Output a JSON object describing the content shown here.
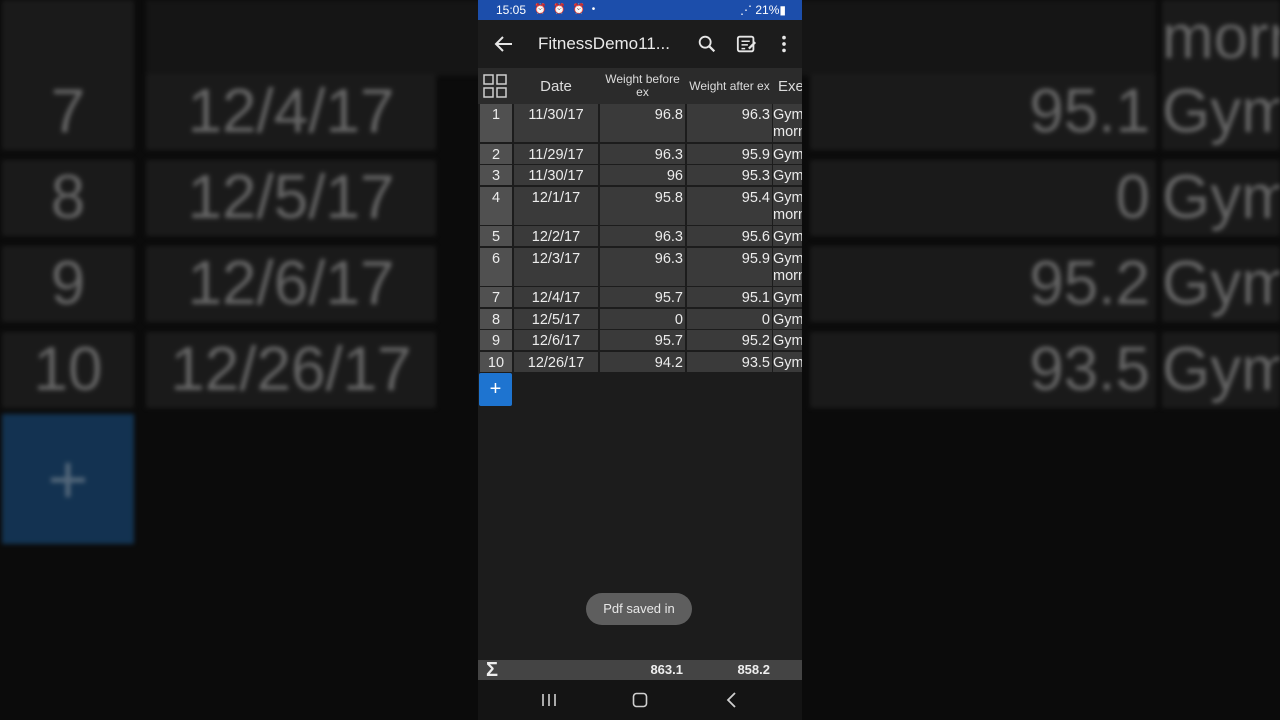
{
  "status_bar": {
    "time": "15:05",
    "notification_icons": "⏰ ⏰ ⏰ •",
    "battery": "21%"
  },
  "app_bar": {
    "title": "FitnessDemo11..."
  },
  "table": {
    "headers": [
      "Date",
      "Weight before ex",
      "Weight after ex",
      "Exe"
    ],
    "rows": [
      {
        "n": "1",
        "date": "11/30/17",
        "before": "96.8",
        "after": "96.3",
        "ex": "Gym morn"
      },
      {
        "n": "2",
        "date": "11/29/17",
        "before": "96.3",
        "after": "95.9",
        "ex": "Gym"
      },
      {
        "n": "3",
        "date": "11/30/17",
        "before": "96",
        "after": "95.3",
        "ex": "Gym"
      },
      {
        "n": "4",
        "date": "12/1/17",
        "before": "95.8",
        "after": "95.4",
        "ex": "Gym morn"
      },
      {
        "n": "5",
        "date": "12/2/17",
        "before": "96.3",
        "after": "95.6",
        "ex": "Gym"
      },
      {
        "n": "6",
        "date": "12/3/17",
        "before": "96.3",
        "after": "95.9",
        "ex": "Gym morn"
      },
      {
        "n": "7",
        "date": "12/4/17",
        "before": "95.7",
        "after": "95.1",
        "ex": "Gym"
      },
      {
        "n": "8",
        "date": "12/5/17",
        "before": "0",
        "after": "0",
        "ex": "Gym"
      },
      {
        "n": "9",
        "date": "12/6/17",
        "before": "95.7",
        "after": "95.2",
        "ex": "Gym"
      },
      {
        "n": "10",
        "date": "12/26/17",
        "before": "94.2",
        "after": "93.5",
        "ex": "Gym"
      }
    ],
    "sum_before": "863.1",
    "sum_after": "858.2"
  },
  "add_row_label": "+",
  "toast": "Pdf saved in",
  "background_zoom": {
    "header_fragment": "morn",
    "rows": [
      {
        "n": "7",
        "date": "12/4/17",
        "after": "95.1",
        "ex": "Gym"
      },
      {
        "n": "8",
        "date": "12/5/17",
        "after": "0",
        "ex": "Gym"
      },
      {
        "n": "9",
        "date": "12/6/17",
        "after": "95.2",
        "ex": "Gym"
      },
      {
        "n": "10",
        "date": "12/26/17",
        "after": "93.5",
        "ex": "Gym"
      }
    ],
    "plus": "+"
  },
  "colors": {
    "status_bar": "#1c4eab",
    "accent": "#1e74d0",
    "cell": "#3a3a3a",
    "toast": "#5e5e5e"
  }
}
